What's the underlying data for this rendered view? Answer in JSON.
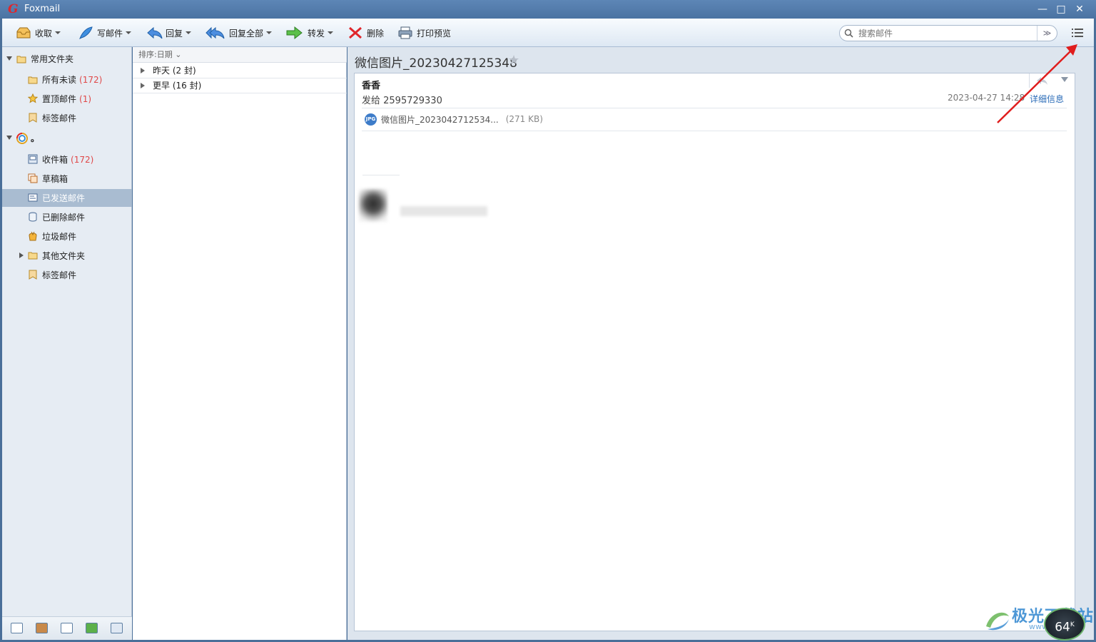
{
  "window": {
    "title": "Foxmail",
    "logo_letter": "G",
    "minimize_glyph": "—",
    "maximize_glyph": "□",
    "close_glyph": "✕"
  },
  "toolbar": {
    "receive": "收取",
    "compose": "写邮件",
    "reply": "回复",
    "reply_all": "回复全部",
    "forward": "转发",
    "delete": "删除",
    "print_preview": "打印预览"
  },
  "search": {
    "placeholder": "搜索邮件",
    "dropdown_glyph": "≫"
  },
  "sidebar": {
    "common_folders": "常用文件夹",
    "all_unread": "所有未读",
    "all_unread_count": "(172)",
    "pinned": "置顶邮件",
    "pinned_count": "(1)",
    "tagged": "标签邮件",
    "account_name": "。",
    "inbox": "收件箱",
    "inbox_count": "(172)",
    "drafts": "草稿箱",
    "sent": "已发送邮件",
    "deleted": "已删除邮件",
    "junk": "垃圾邮件",
    "other_folders": "其他文件夹",
    "tagged2": "标签邮件"
  },
  "message_list": {
    "sort_label": "排序:日期 ⌄",
    "groups": [
      {
        "label": "昨天 (2 封)"
      },
      {
        "label": "更早 (16 封)"
      }
    ]
  },
  "reader": {
    "subject": "微信图片_20230427125348",
    "star_glyph": "★",
    "sender": "香香",
    "to_line": "发给 2595729330",
    "date": "2023-04-27 14:28",
    "detail_link": "详细信息",
    "attachment_icon_text": "JPG",
    "attachment_name": "微信图片_2023042712534...",
    "attachment_size": "(271 KB)"
  },
  "watermark": {
    "text": "极光下载站",
    "sub": "www.xz7.com",
    "speed_value": "64",
    "speed_unit": "K"
  },
  "colors": {
    "title_bar": "#4b73a2",
    "selected_folder": "#a9bcd1",
    "unread_count": "#e04848",
    "link": "#2b6cb8",
    "annotation_arrow": "#e01d1d"
  }
}
